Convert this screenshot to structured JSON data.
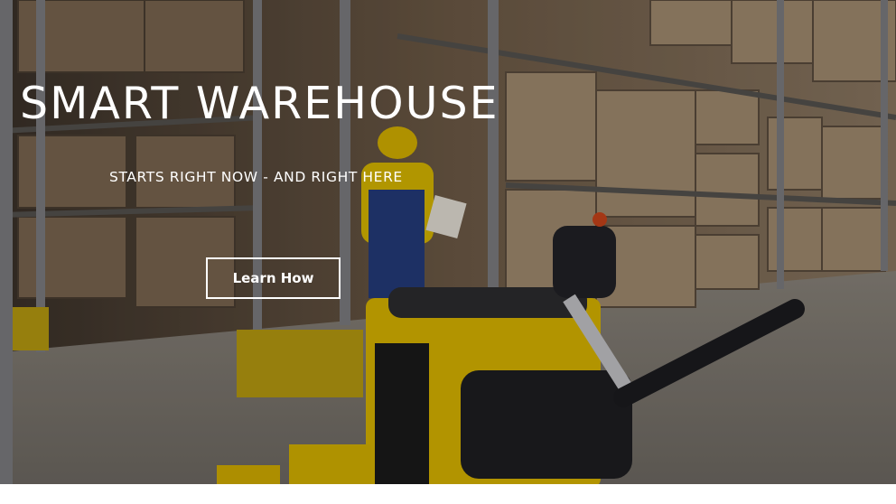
{
  "hero": {
    "title": "SMART WAREHOUSE",
    "subtitle": "STARTS RIGHT NOW - AND RIGHT HERE",
    "cta_label": "Learn How"
  },
  "background": {
    "subject": "warehouse-photo",
    "colors": {
      "box": "#8f7a60",
      "shelf": "#6f6a66",
      "forklift_yellow": "#e2c100",
      "floor": "#9c968d"
    }
  }
}
